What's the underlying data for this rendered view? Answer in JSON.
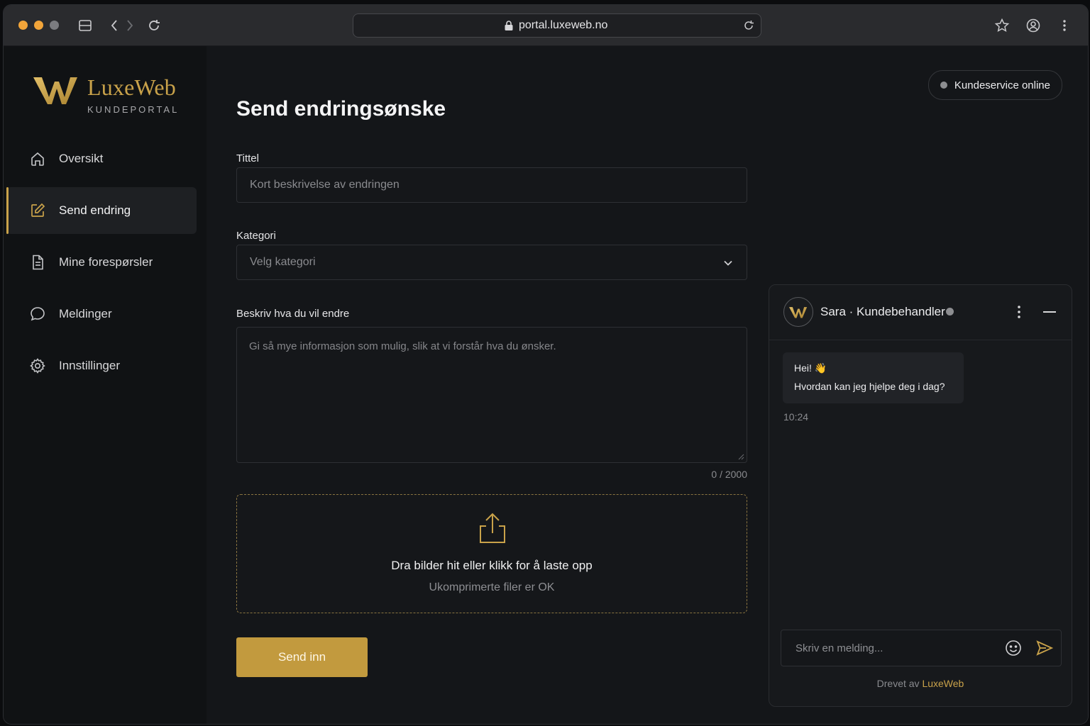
{
  "browser": {
    "url": "portal.luxeweb.no"
  },
  "brand": {
    "name": "LuxeWeb",
    "subtitle": "KUNDEPORTAL",
    "accent": "#c9a24a"
  },
  "sidebar": {
    "items": [
      {
        "label": "Oversikt",
        "icon": "home-icon",
        "active": false
      },
      {
        "label": "Send endring",
        "icon": "edit-icon",
        "active": true
      },
      {
        "label": "Mine forespørsler",
        "icon": "document-icon",
        "active": false
      },
      {
        "label": "Meldinger",
        "icon": "chat-bubble-icon",
        "active": false
      },
      {
        "label": "Innstillinger",
        "icon": "gear-icon",
        "active": false
      }
    ]
  },
  "status": {
    "label": "Kundeservice online"
  },
  "form": {
    "title": "Send endringsønske",
    "title_label": "Tittel",
    "title_placeholder": "Kort beskrivelse av endringen",
    "category_label": "Kategori",
    "category_placeholder": "Velg kategori",
    "description_label": "Beskriv hva du vil endre",
    "description_placeholder": "Gi så mye informasjon som mulig, slik at vi forstår hva du ønsker.",
    "counter": "0 / 2000",
    "upload_title": "Dra bilder hit eller klikk for å laste opp",
    "upload_subtitle": "Ukomprimerte filer er OK",
    "submit_label": "Send inn"
  },
  "chat": {
    "agent_name": "Sara · Kundebehandler",
    "messages": [
      {
        "lines": [
          "Hei! 👋",
          "Hvordan kan jeg hjelpe deg i dag?"
        ],
        "time": "10:24"
      }
    ],
    "input_placeholder": "Skriv en melding...",
    "powered_prefix": "Drevet av",
    "powered_brand": "LuxeWeb"
  }
}
